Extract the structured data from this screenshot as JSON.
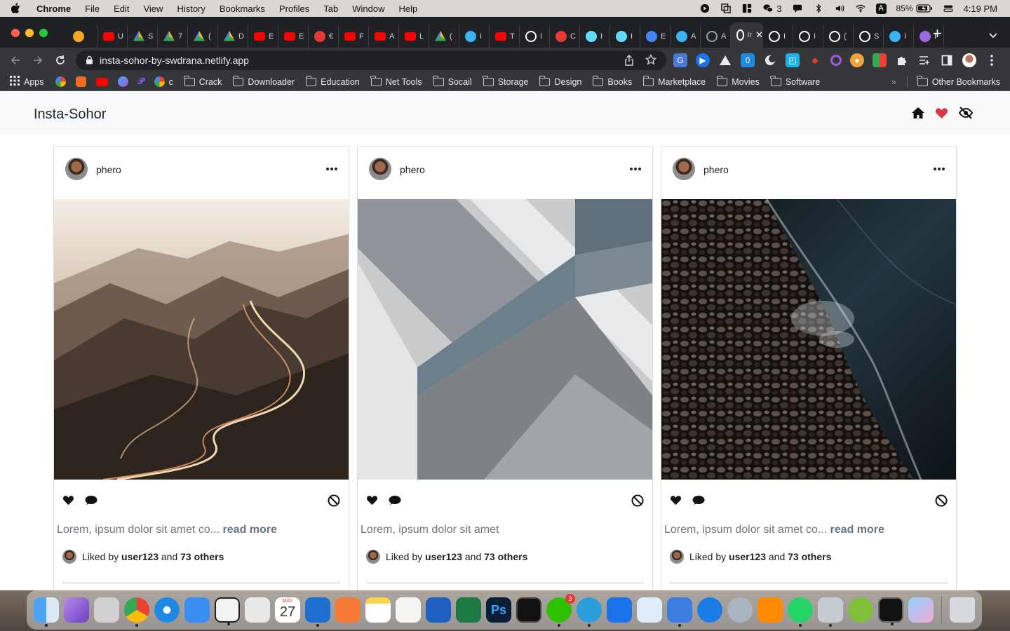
{
  "menubar": {
    "app_name": "Chrome",
    "items": [
      "File",
      "Edit",
      "View",
      "History",
      "Bookmarks",
      "Profiles",
      "Tab",
      "Window",
      "Help"
    ],
    "wechat_count": "3",
    "input_source": "A",
    "battery": "85%",
    "clock": "4:19 PM"
  },
  "browser": {
    "tabs": [
      {
        "icon": "infinity-icon",
        "color": "#f5a623",
        "text": ""
      },
      {
        "icon": "youtube-icon",
        "color": "#ff0000",
        "text": "U"
      },
      {
        "icon": "drive-icon",
        "color": "#34a853",
        "text": "S"
      },
      {
        "icon": "drive-icon",
        "color": "#34a853",
        "text": "7"
      },
      {
        "icon": "drive-icon",
        "color": "#34a853",
        "text": "("
      },
      {
        "icon": "drive-icon",
        "color": "#34a853",
        "text": "D"
      },
      {
        "icon": "youtube-icon",
        "color": "#ff0000",
        "text": "E"
      },
      {
        "icon": "youtube-icon",
        "color": "#ff0000",
        "text": "E"
      },
      {
        "icon": "target-icon",
        "color": "#e53935",
        "text": "€"
      },
      {
        "icon": "youtube-icon",
        "color": "#ff0000",
        "text": "F"
      },
      {
        "icon": "youtube-icon",
        "color": "#ff0000",
        "text": "A"
      },
      {
        "icon": "youtube-icon",
        "color": "#ff0000",
        "text": "L"
      },
      {
        "icon": "drive-icon",
        "color": "#34a853",
        "text": "("
      },
      {
        "icon": "bubble-icon",
        "color": "#3ab4f2",
        "text": "I"
      },
      {
        "icon": "youtube-icon",
        "color": "#ff0000",
        "text": "T"
      },
      {
        "icon": "globe-icon",
        "color": "#ffffff",
        "text": "I"
      },
      {
        "icon": "pdf-icon",
        "color": "#e53935",
        "text": "C"
      },
      {
        "icon": "react-icon",
        "color": "#61dafb",
        "text": "I"
      },
      {
        "icon": "react-icon",
        "color": "#61dafb",
        "text": "I"
      },
      {
        "icon": "circle-c-icon",
        "color": "#4285f4",
        "text": "E"
      },
      {
        "icon": "bubble-icon",
        "color": "#3ab4f2",
        "text": "A"
      },
      {
        "icon": "globe-icon",
        "color": "#9aa0a6",
        "text": "A"
      },
      {
        "icon": "globe-icon",
        "color": "#ffffff",
        "text": "In"
      },
      {
        "icon": "globe-icon",
        "color": "#ffffff",
        "text": "I"
      },
      {
        "icon": "globe-icon",
        "color": "#ffffff",
        "text": "I"
      },
      {
        "icon": "globe-icon",
        "color": "#ffffff",
        "text": "("
      },
      {
        "icon": "globe-icon",
        "color": "#ffffff",
        "text": "S"
      },
      {
        "icon": "dot-icon",
        "color": "#3ab4f2",
        "text": "I"
      },
      {
        "icon": "stack-icon",
        "color": "#9c6ade",
        "text": "I"
      }
    ],
    "active_tab_label": "In",
    "url": "insta-sohor-by-swdrana.netlify.app"
  },
  "bookmarks": {
    "apps_label": "Apps",
    "c_label": "c",
    "folders": [
      "Crack",
      "Downloader",
      "Education",
      "Net Tools",
      "Socail",
      "Storage",
      "Design",
      "Books",
      "Marketplace",
      "Movies",
      "Software"
    ],
    "overflow": "»",
    "other_label": "Other Bookmarks"
  },
  "site": {
    "brand": "Insta-Sohor",
    "posts": [
      {
        "username": "phero",
        "image_name": "winding-mountain-road",
        "caption": "Lorem, ipsum dolor sit amet co...",
        "read_more": " read more",
        "liked_by": "Liked by",
        "liker": "user123",
        "and": "and",
        "others": "73 others"
      },
      {
        "username": "phero",
        "image_name": "grey-geometric-abstract",
        "caption": "Lorem, ipsum dolor sit amet",
        "read_more": "",
        "liked_by": "Liked by",
        "liker": "user123",
        "and": "and",
        "others": "73 others"
      },
      {
        "username": "phero",
        "image_name": "pebbles-at-water",
        "caption": "Lorem, ipsum dolor sit amet co...",
        "read_more": " read more",
        "liked_by": "Liked by",
        "liker": "user123",
        "and": "and",
        "others": "73 others"
      }
    ]
  },
  "dock": {
    "calendar_month": "MAY",
    "calendar_day": "27",
    "wechat_badge": "3"
  },
  "colors": {
    "heart_red": "#dc3545",
    "chrome_dark": "#202124",
    "toolbar": "#35363a"
  }
}
